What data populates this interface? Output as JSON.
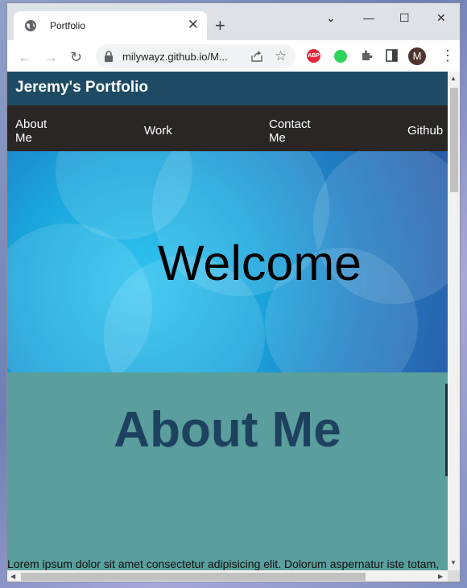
{
  "browser": {
    "tab_title": "Portfolio",
    "tab_close": "✕",
    "new_tab": "+",
    "url": "milywayz.github.io/M...",
    "profile_initial": "M",
    "abp_label": "ABP",
    "window_controls": {
      "minimize": "—",
      "maximize": "☐",
      "close": "✕",
      "tab_search": "⌄"
    },
    "nav": {
      "back": "←",
      "forward": "→",
      "reload": "↻"
    },
    "menu": "⋮"
  },
  "site": {
    "title": "Jeremy's Portfolio",
    "nav": [
      "About Me",
      "Work",
      "Contact Me",
      "Github"
    ],
    "hero_title": "Welcome",
    "about": {
      "title": "About Me",
      "text": "Lorem ipsum dolor sit amet consectetur adipisicing elit. Dolorum aspernatur iste totam,"
    }
  },
  "colors": {
    "header_bg": "#1e4a63",
    "nav_bg": "#2a2626",
    "about_bg": "#5a9e9d",
    "about_title": "#1e4160"
  }
}
